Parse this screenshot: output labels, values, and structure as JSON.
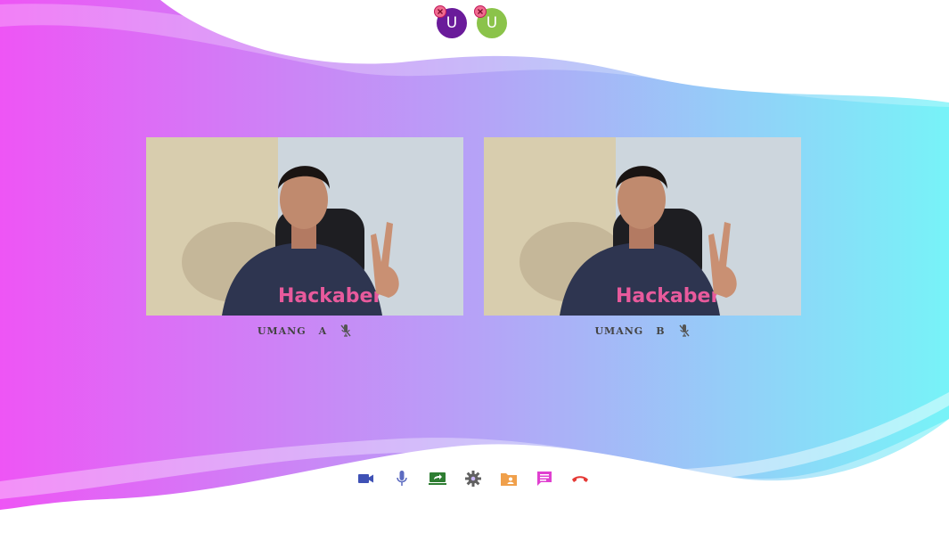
{
  "participants_bar": {
    "avatars": [
      {
        "initial": "U",
        "color": "#6a1b9a"
      },
      {
        "initial": "U",
        "color": "#8bc34a"
      }
    ]
  },
  "videos": [
    {
      "name_first": "UMANG",
      "name_last": "A",
      "mic": "muted"
    },
    {
      "name_first": "UMANG",
      "name_last": "B",
      "mic": "muted"
    }
  ],
  "toolbar": {
    "items": [
      {
        "icon": "video-camera-icon",
        "color": "#3f51b5"
      },
      {
        "icon": "microphone-icon",
        "color": "#5c6bc0"
      },
      {
        "icon": "screen-share-icon",
        "color": "#2e7d32"
      },
      {
        "icon": "settings-gear-icon",
        "color": "#616161"
      },
      {
        "icon": "contacts-folder-icon",
        "color": "#f0a04b"
      },
      {
        "icon": "chat-icon",
        "color": "#e040d0"
      },
      {
        "icon": "end-call-icon",
        "color": "#e53935"
      }
    ]
  },
  "colors": {
    "gradient_left": "#ee55f5",
    "gradient_mid": "#b6a2f7",
    "gradient_right": "#77f3f8"
  }
}
